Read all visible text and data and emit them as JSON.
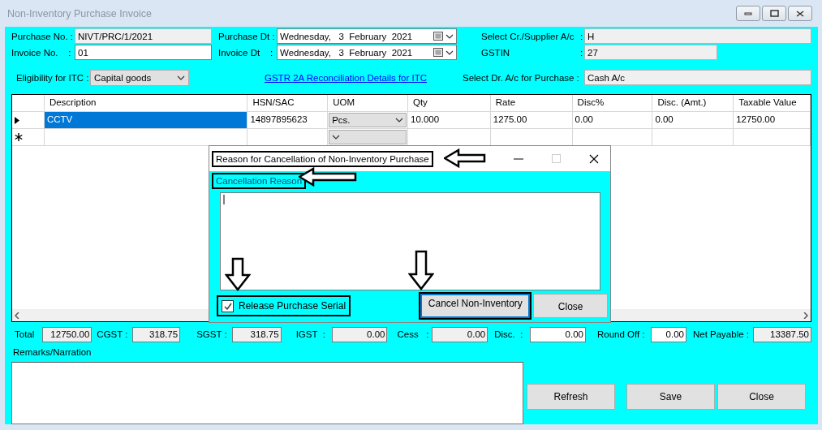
{
  "window": {
    "title": "Non-Inventory Purchase Invoice"
  },
  "form": {
    "purchase_no": {
      "label": "Purchase No. :",
      "value": "NIVT/PRC/1/2021"
    },
    "invoice_no": {
      "label": "Invoice No.    :",
      "value": "01"
    },
    "purchase_dt": {
      "label": "Purchase Dt :",
      "value": "Wednesday,   3  February  2021"
    },
    "invoice_dt": {
      "label": "Invoice Dt    :",
      "value": "Wednesday,   3  February  2021"
    },
    "supplier": {
      "label": "Select Cr./Supplier A/c",
      "colon": ":",
      "value": "H"
    },
    "gstin": {
      "label": "GSTIN",
      "colon": ":",
      "value": "27"
    },
    "itc": {
      "label": "Eligibility for ITC :",
      "value": "Capital goods"
    },
    "link": "GSTR 2A Reconciliation Details for ITC",
    "dr_account": {
      "label": "Select Dr. A/c for Purchase :",
      "value": "Cash A/c"
    }
  },
  "grid": {
    "columns": [
      "Description",
      "HSN/SAC",
      "UOM",
      "Qty",
      "Rate",
      "Disc%",
      "Disc. (Amt.)",
      "Taxable Value"
    ],
    "rows": [
      {
        "kind": "current",
        "selected": true,
        "cells": [
          "CCTV",
          "14897895623",
          "Pcs.",
          "10.000",
          "1275.00",
          "0.00",
          "0.00",
          "12750.00"
        ]
      },
      {
        "kind": "new",
        "selected": false,
        "cells": []
      }
    ]
  },
  "dialog": {
    "title": "Reason for Cancellation of Non-Inventory Purchase",
    "label": "Cancellation Reason",
    "checkbox": {
      "label": "Release Purchase Serial",
      "checked": true
    },
    "buttons": [
      {
        "label": "Cancel Non-Inventory",
        "focused": true
      },
      {
        "label": "Close",
        "focused": false
      }
    ]
  },
  "totals": [
    {
      "label": "Total",
      "value": "12750.00",
      "editable": false
    },
    {
      "label": "CGST :",
      "value": "318.75",
      "editable": false
    },
    {
      "label": "SGST :",
      "value": "318.75",
      "editable": false
    },
    {
      "label": "IGST  :",
      "value": "0.00",
      "editable": false
    },
    {
      "label": "Cess   :",
      "value": "0.00",
      "editable": false
    },
    {
      "label": "Disc.  :",
      "value": "0.00",
      "editable": true
    },
    {
      "label": "Round Off :",
      "value": "0.00",
      "editable": true
    },
    {
      "label": "Net Payable :",
      "value": "13387.50",
      "editable": false
    }
  ],
  "remarks": {
    "label": "Remarks/Narration"
  },
  "buttons": [
    "Refresh",
    "Save",
    "Close"
  ]
}
